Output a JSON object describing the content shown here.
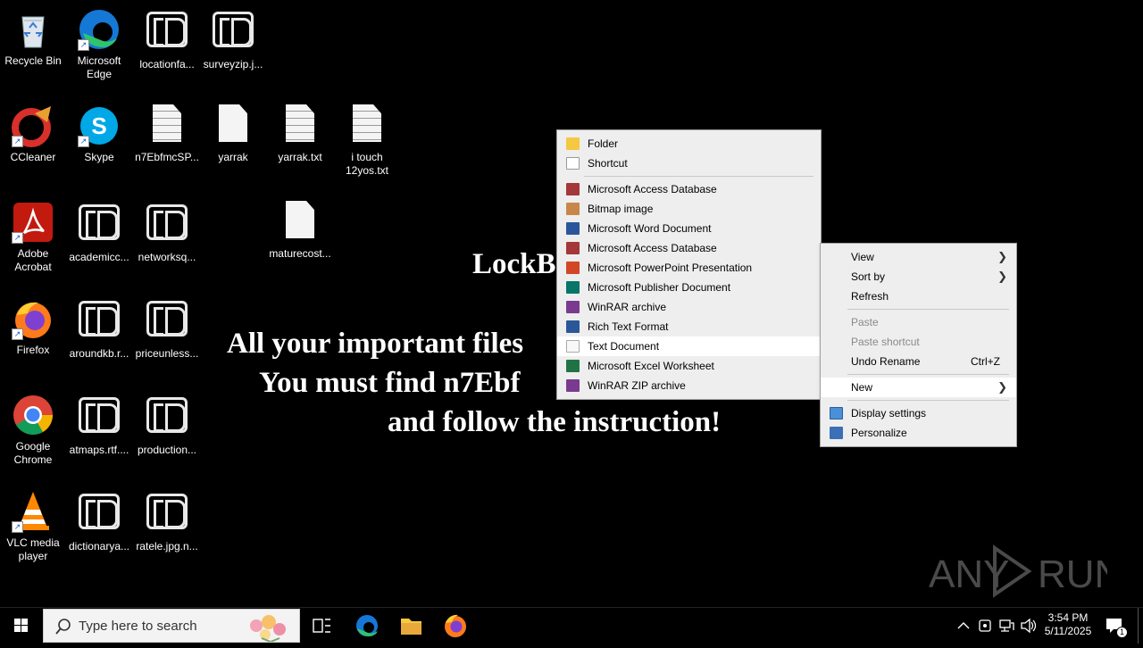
{
  "desktop": {
    "icons": [
      {
        "label": "Recycle Bin",
        "type": "recycle"
      },
      {
        "label": "Microsoft Edge",
        "type": "edge"
      },
      {
        "label": "locationfa...",
        "type": "lockbit"
      },
      {
        "label": "surveyzip.j...",
        "type": "lockbit"
      },
      {
        "label": "CCleaner",
        "type": "ccleaner"
      },
      {
        "label": "Skype",
        "type": "skype"
      },
      {
        "label": "n7EbfmcSP...",
        "type": "doc-lined"
      },
      {
        "label": "yarrak",
        "type": "doc"
      },
      {
        "label": "yarrak.txt",
        "type": "doc-lined"
      },
      {
        "label": "i touch 12yos.txt",
        "type": "doc-lined"
      },
      {
        "label": "Adobe Acrobat",
        "type": "acrobat"
      },
      {
        "label": "academicc...",
        "type": "lockbit"
      },
      {
        "label": "networksq...",
        "type": "lockbit"
      },
      {
        "label": "maturecost...",
        "type": "doc"
      },
      {
        "label": "Firefox",
        "type": "firefox"
      },
      {
        "label": "aroundkb.r...",
        "type": "lockbit"
      },
      {
        "label": "priceunless...",
        "type": "lockbit"
      },
      {
        "label": "Google Chrome",
        "type": "chrome"
      },
      {
        "label": "atmaps.rtf....",
        "type": "lockbit"
      },
      {
        "label": "production...",
        "type": "lockbit"
      },
      {
        "label": "VLC media player",
        "type": "vlc"
      },
      {
        "label": "dictionarya...",
        "type": "lockbit"
      },
      {
        "label": "ratele.jpg.n...",
        "type": "lockbit"
      }
    ]
  },
  "ransom_note": {
    "title": "LockB",
    "line1": "All your important files",
    "line2": "You must find n7Ebf",
    "line3": "and follow the instruction!"
  },
  "new_submenu": {
    "items": [
      {
        "label": "Folder",
        "icon": "folder-icon",
        "color": "#f5c842"
      },
      {
        "label": "Shortcut",
        "icon": "shortcut-icon",
        "color": "#3c78c8"
      },
      {
        "label": "Microsoft Access Database",
        "icon": "access-icon",
        "color": "#a4373a"
      },
      {
        "label": "Bitmap image",
        "icon": "bitmap-icon",
        "color": "#c8874a"
      },
      {
        "label": "Microsoft Word Document",
        "icon": "word-icon",
        "color": "#2b579a"
      },
      {
        "label": "Microsoft Access Database",
        "icon": "access-icon",
        "color": "#a4373a"
      },
      {
        "label": "Microsoft PowerPoint Presentation",
        "icon": "powerpoint-icon",
        "color": "#d24726"
      },
      {
        "label": "Microsoft Publisher Document",
        "icon": "publisher-icon",
        "color": "#077568"
      },
      {
        "label": "WinRAR archive",
        "icon": "winrar-icon",
        "color": "#7a3b8f"
      },
      {
        "label": "Rich Text Format",
        "icon": "rtf-icon",
        "color": "#2b579a"
      },
      {
        "label": "Text Document",
        "icon": "text-document-icon",
        "color": "#dcdcdc"
      },
      {
        "label": "Microsoft Excel Worksheet",
        "icon": "excel-icon",
        "color": "#217346"
      },
      {
        "label": "WinRAR ZIP archive",
        "icon": "winrar-zip-icon",
        "color": "#7a3b8f"
      }
    ],
    "highlighted": "Text Document"
  },
  "context_menu": {
    "view": "View",
    "sort_by": "Sort by",
    "refresh": "Refresh",
    "paste": "Paste",
    "paste_shortcut": "Paste shortcut",
    "undo_rename": "Undo Rename",
    "undo_shortcut": "Ctrl+Z",
    "new": "New",
    "display_settings": "Display settings",
    "personalize": "Personalize"
  },
  "taskbar": {
    "search_placeholder": "Type here to search",
    "time": "3:54 PM",
    "date": "5/11/2025",
    "notification_count": "1"
  },
  "watermark": "ANY RUN"
}
